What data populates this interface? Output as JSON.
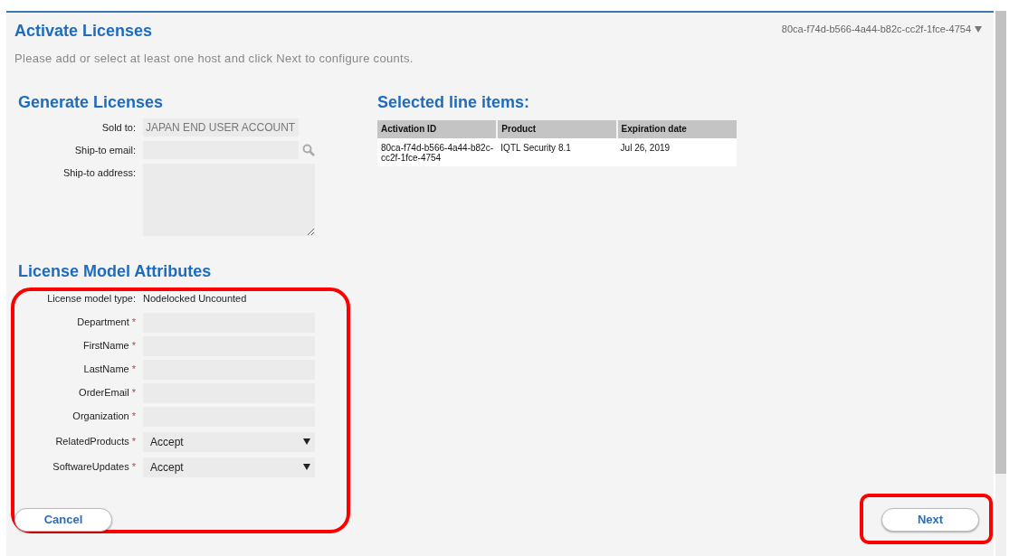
{
  "header": {
    "title": "Activate Licenses",
    "subtitle": "Please add or select at least one host and click Next to configure counts.",
    "activation_selector": "80ca-f74d-b566-4a44-b82c-cc2f-1fce-4754"
  },
  "generate_licenses": {
    "heading": "Generate Licenses",
    "fields": [
      {
        "label": "Sold to:",
        "kind": "readonly",
        "value": "JAPAN END USER ACCOUNT"
      },
      {
        "label": "Ship-to email:",
        "kind": "search"
      },
      {
        "label": "Ship-to address:",
        "kind": "textarea"
      }
    ]
  },
  "selected_line_items": {
    "heading": "Selected line items:",
    "columns": [
      "Activation ID",
      "Product",
      "Expiration date"
    ],
    "rows": [
      [
        "80ca-f74d-b566-4a44-b82c-cc2f-1fce-4754",
        "IQTL Security 8.1",
        "Jul 26, 2019"
      ]
    ]
  },
  "license_model_attributes": {
    "heading": "License Model Attributes",
    "type_label": "License model type:",
    "type_value": "Nodelocked Uncounted",
    "required_marker": "*",
    "highlighted": true,
    "fields": [
      {
        "label": "Department",
        "required": true,
        "kind": "text"
      },
      {
        "label": "FirstName",
        "required": true,
        "kind": "text"
      },
      {
        "label": "LastName",
        "required": true,
        "kind": "text"
      },
      {
        "label": "OrderEmail",
        "required": true,
        "kind": "text"
      },
      {
        "label": "Organization",
        "required": true,
        "kind": "text"
      },
      {
        "label": "RelatedProducts",
        "required": true,
        "kind": "select",
        "value": "Accept"
      },
      {
        "label": "SoftwareUpdates",
        "required": true,
        "kind": "select",
        "value": "Accept"
      }
    ]
  },
  "buttons": {
    "cancel": {
      "label": "Cancel"
    },
    "next": {
      "label": "Next",
      "highlighted": true
    }
  }
}
